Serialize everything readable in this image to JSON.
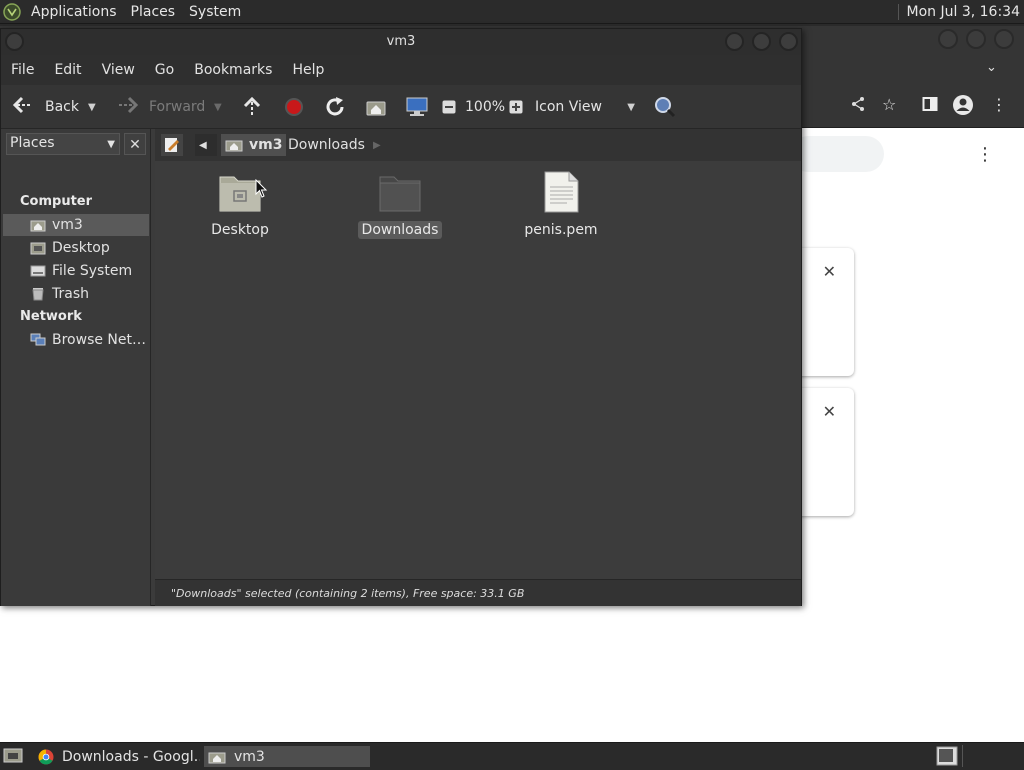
{
  "top_panel": {
    "menus": [
      "Applications",
      "Places",
      "System"
    ],
    "clock": "Mon Jul 3, 16:34"
  },
  "file_manager": {
    "title": "vm3",
    "menubar": [
      "File",
      "Edit",
      "View",
      "Go",
      "Bookmarks",
      "Help"
    ],
    "toolbar": {
      "back_label": "Back",
      "forward_label": "Forward",
      "zoom": "100%",
      "view_mode": "Icon View"
    },
    "sidebar": {
      "selector": "Places",
      "sections": [
        {
          "heading": "Computer",
          "items": [
            "vm3",
            "Desktop",
            "File System",
            "Trash"
          ]
        },
        {
          "heading": "Network",
          "items": [
            "Browse Net…"
          ]
        }
      ]
    },
    "breadcrumbs": [
      "vm3",
      "Downloads"
    ],
    "files": [
      {
        "name": "Desktop",
        "type": "folder",
        "selected": false
      },
      {
        "name": "Downloads",
        "type": "folder",
        "selected": true
      },
      {
        "name": "penis.pem",
        "type": "file",
        "selected": false
      }
    ],
    "status": "\"Downloads\" selected (containing 2 items), Free space: 33.1 GB"
  },
  "taskbar": {
    "tasks": [
      {
        "label": "Downloads - Googl…",
        "active": false
      },
      {
        "label": "vm3",
        "active": true
      }
    ]
  }
}
